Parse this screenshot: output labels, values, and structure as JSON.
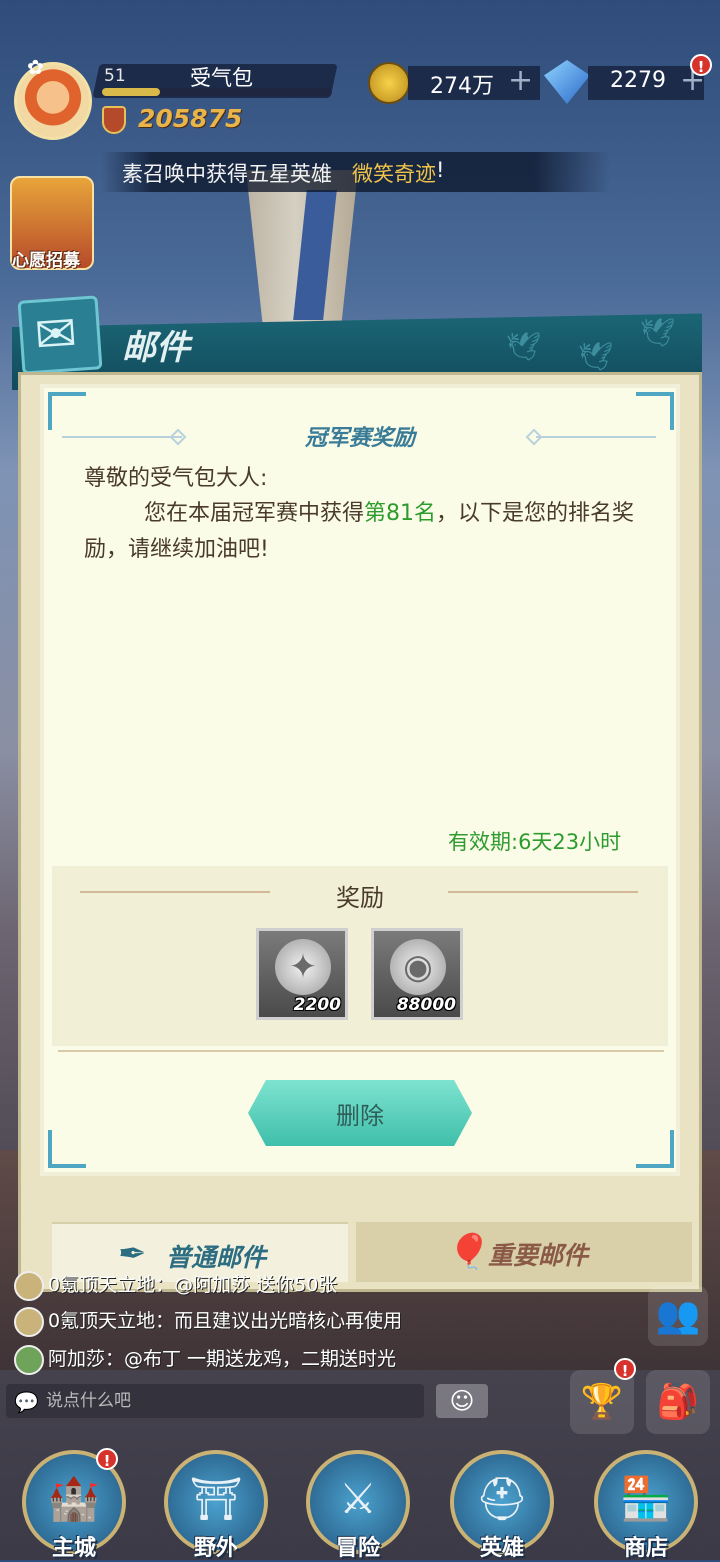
{
  "player": {
    "level": "51",
    "name": "受气包",
    "exp_progress": 0.25,
    "power": "205875"
  },
  "currency": {
    "gold": "274万",
    "gems": "2279",
    "gems_alert": "!"
  },
  "marquee": {
    "prefix": "素召唤中获得五星英雄",
    "hero": "微笑奇迹",
    "suffix": "!"
  },
  "wish_label": "心愿招募",
  "mail": {
    "header_title": "邮件",
    "subject": "冠军赛奖励",
    "greeting": "尊敬的受气包大人:",
    "body_pre": "您在本届冠军赛中获得",
    "rank": "第81名",
    "body_post": "，以下是您的排名奖励，请继续加油吧!",
    "validity": "有效期:6天23小时",
    "reward_title": "奖励",
    "rewards": [
      {
        "icon": "honor-badge-icon",
        "qty": "2200"
      },
      {
        "icon": "silver-coin-icon",
        "qty": "88000"
      }
    ],
    "delete_label": "删除",
    "tabs": {
      "normal": "普通邮件",
      "important": "重要邮件"
    }
  },
  "chat": {
    "lines": [
      "0氪顶天立地：@阿加莎 送你50张",
      "0氪顶天立地：而且建议出光暗核心再使用",
      "阿加莎：@布丁 一期送龙鸡，二期送时光"
    ],
    "placeholder": "说点什么吧"
  },
  "side_buttons": {
    "rank_alert": "!"
  },
  "nav": {
    "items": [
      "主城",
      "野外",
      "冒险",
      "英雄",
      "商店"
    ],
    "main_city_alert": "!"
  },
  "colors": {
    "accent_green": "#2e9b2e",
    "mail_teal": "#3a7c98",
    "delete_button": "#5ccfb9",
    "gold_text": "#e9b44a",
    "marquee_highlight": "#f0c44a"
  }
}
